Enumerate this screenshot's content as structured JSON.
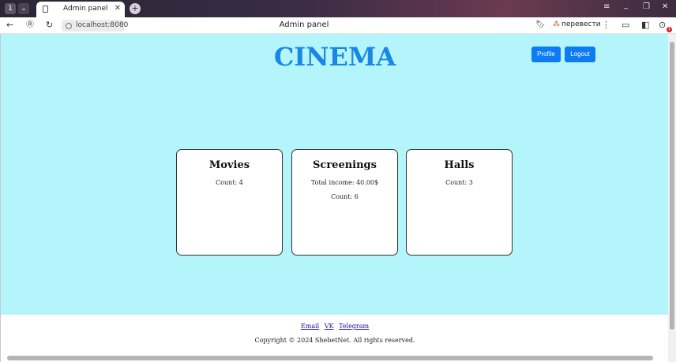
{
  "browser": {
    "tab_count": "1",
    "tab_title": "Admin panel",
    "close_glyph": "✕",
    "new_tab_glyph": "+",
    "url": "localhost:8080",
    "page_title": "Admin panel",
    "translate_label": "перевести",
    "notification_count": "1",
    "window_controls": {
      "menu": "≡",
      "minimize": "_",
      "restore": "❐",
      "close": "✕"
    }
  },
  "header": {
    "brand": "CINEMA",
    "profile_label": "Profile",
    "logout_label": "Logout"
  },
  "cards": [
    {
      "title": "Movies",
      "lines": [
        "Count: 4"
      ]
    },
    {
      "title": "Screenings",
      "lines": [
        "Total income: 40.00$",
        "Count: 6"
      ]
    },
    {
      "title": "Halls",
      "lines": [
        "Count: 3"
      ]
    }
  ],
  "footer": {
    "links": [
      "Email",
      "VK",
      "Telegram"
    ],
    "copyright": "Copyright © 2024 ShebetNet. All rights reserved."
  },
  "colors": {
    "page_background": "#b3f5fb",
    "brand": "#1a86e6",
    "button": "#0d7cf2"
  }
}
